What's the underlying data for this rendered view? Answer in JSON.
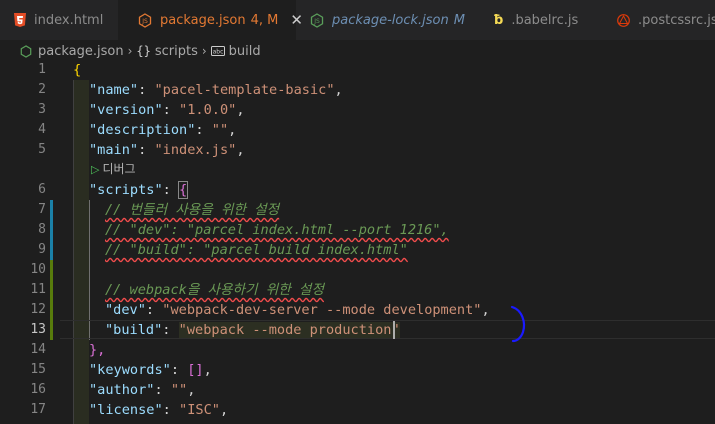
{
  "tabs": [
    {
      "label": "index.html",
      "modified": ""
    },
    {
      "label": "package.json",
      "modified": "4, M"
    },
    {
      "label": "package-lock.json",
      "modified": "M"
    },
    {
      "label": ".babelrc.js",
      "modified": ""
    },
    {
      "label": ".postcssrc.js",
      "modified": ""
    }
  ],
  "breadcrumb": [
    "package.json",
    "scripts",
    "build"
  ],
  "codelens": "디버그",
  "line_numbers": [
    "1",
    "2",
    "3",
    "4",
    "5",
    "6",
    "7",
    "8",
    "9",
    "10",
    "11",
    "12",
    "13",
    "14",
    "15",
    "16",
    "17"
  ],
  "current_line": "13",
  "code": {
    "l1": "{",
    "l2": {
      "key": "\"name\"",
      "value": "\"pacel-template-basic\""
    },
    "l3": {
      "key": "\"version\"",
      "value": "\"1.0.0\""
    },
    "l4": {
      "key": "\"description\"",
      "value": "\"\""
    },
    "l5": {
      "key": "\"main\"",
      "value": "\"index.js\""
    },
    "l6": {
      "key": "\"scripts\"",
      "brace": "{"
    },
    "l7": "// 번들러 사용을 위한 설정",
    "l8": "// \"dev\": \"parcel index.html --port 1216\",",
    "l9": "// \"build\": \"parcel build index.html\"",
    "l11": "// webpack을 사용하기 위한 설정",
    "l12": {
      "key": "\"dev\"",
      "value": "\"webpack-dev-server --mode development\""
    },
    "l13": {
      "key": "\"build\"",
      "value": "\"webpack --mode production\""
    },
    "l14": "},",
    "l15": {
      "key": "\"keywords\"",
      "value": "[]"
    },
    "l16": {
      "key": "\"author\"",
      "value": "\"\""
    },
    "l17": {
      "key": "\"license\"",
      "value": "\"ISC\""
    }
  },
  "colors": {
    "accent": "#e37933",
    "key": "#9cdcfe",
    "string": "#ce9178",
    "comment": "#6a9955",
    "squiggle": "#f14c4c",
    "annotation": "#1a1aff"
  }
}
